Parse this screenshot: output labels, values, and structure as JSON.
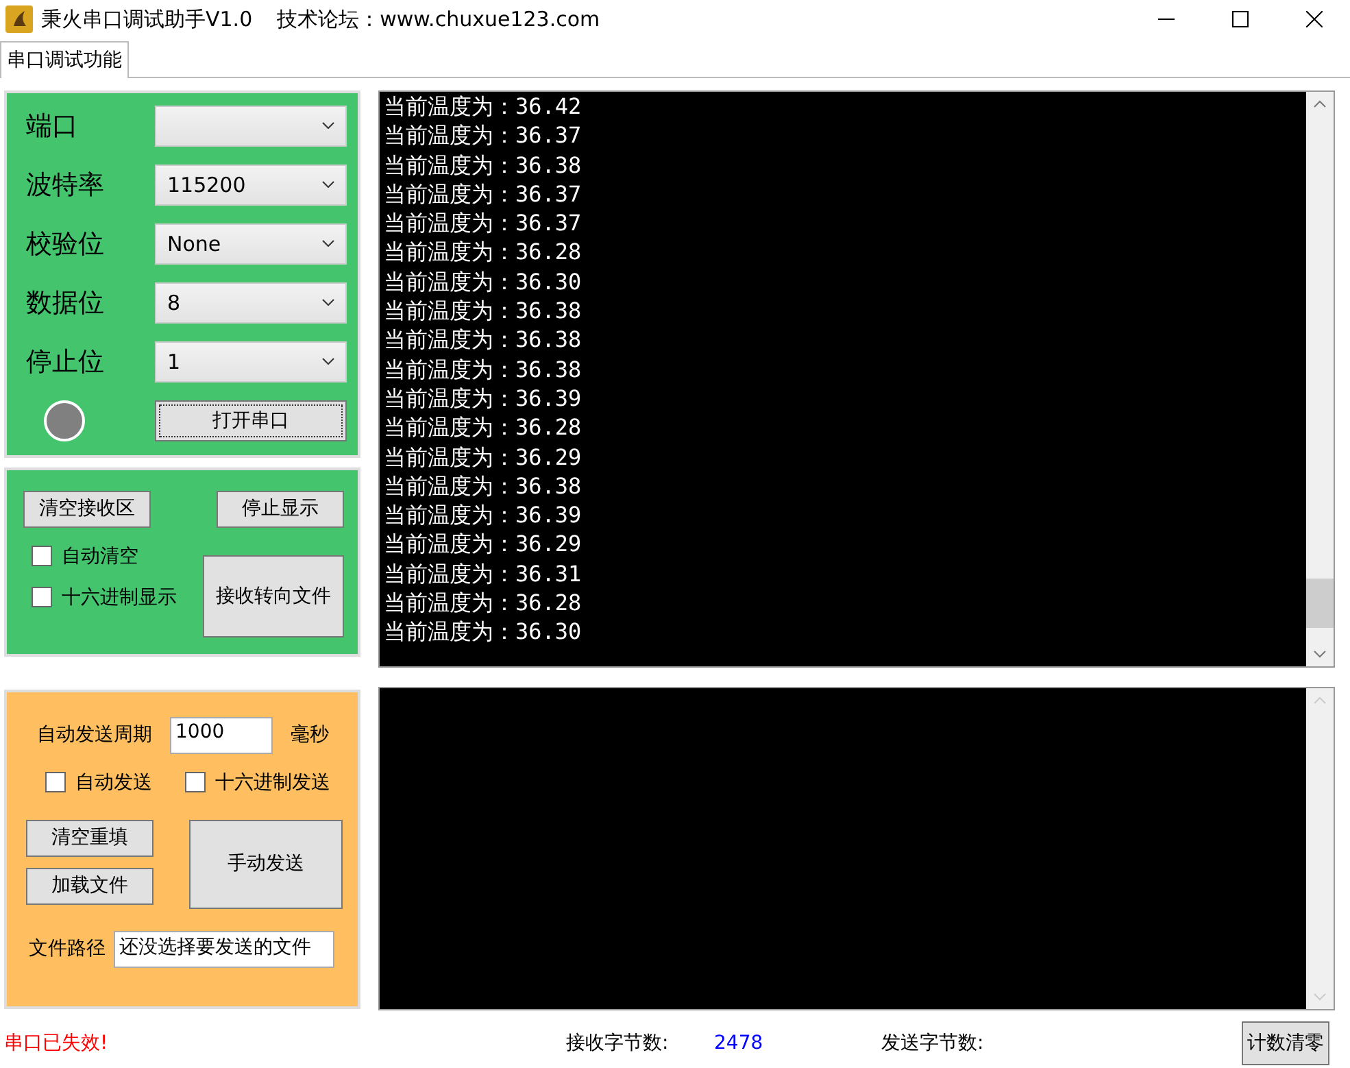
{
  "window": {
    "title": "秉火串口调试助手V1.0",
    "subtitle": "技术论坛：www.chuxue123.com"
  },
  "tabs": [
    {
      "label": "串口调试功能",
      "selected": true
    }
  ],
  "port_settings": {
    "fields": [
      {
        "label": "端口"
      },
      {
        "label": "波特率",
        "value": "115200"
      },
      {
        "label": "校验位",
        "value": "None"
      },
      {
        "label": "数据位",
        "value": "8"
      },
      {
        "label": "停止位",
        "value": "1"
      }
    ],
    "indicator": {
      "on": false
    },
    "open_button": "打开串口"
  },
  "receive_controls": {
    "clear_button": "清空接收区",
    "stop_button": "停止显示",
    "checkboxes": [
      {
        "label": "自动清空",
        "checked": false
      },
      {
        "label": "十六进制显示",
        "checked": false
      }
    ],
    "to_file_button": "接收转向文件"
  },
  "receive_log": [
    "当前温度为：36.42",
    "当前温度为：36.37",
    "当前温度为：36.38",
    "当前温度为：36.37",
    "当前温度为：36.37",
    "当前温度为：36.28",
    "当前温度为：36.30",
    "当前温度为：36.38",
    "当前温度为：36.38",
    "当前温度为：36.38",
    "当前温度为：36.39",
    "当前温度为：36.28",
    "当前温度为：36.29",
    "当前温度为：36.38",
    "当前温度为：36.39",
    "当前温度为：36.29",
    "当前温度为：36.31",
    "当前温度为：36.28",
    "当前温度为：36.30"
  ],
  "send_controls": {
    "period_label": "自动发送周期",
    "period_value": "1000",
    "period_unit": "毫秒",
    "checkboxes": [
      {
        "label": "自动发送",
        "checked": false
      },
      {
        "label": "十六进制发送",
        "checked": false
      }
    ],
    "clear_button": "清空重填",
    "load_button": "加载文件",
    "send_button": "手动发送",
    "path_label": "文件路径",
    "path_value": "还没选择要发送的文件"
  },
  "status_bar": {
    "message": "串口已失效!",
    "received_label": "接收字节数:",
    "received_value": "2478",
    "sent_label": "发送字节数:",
    "reset_button": "计数清零"
  }
}
